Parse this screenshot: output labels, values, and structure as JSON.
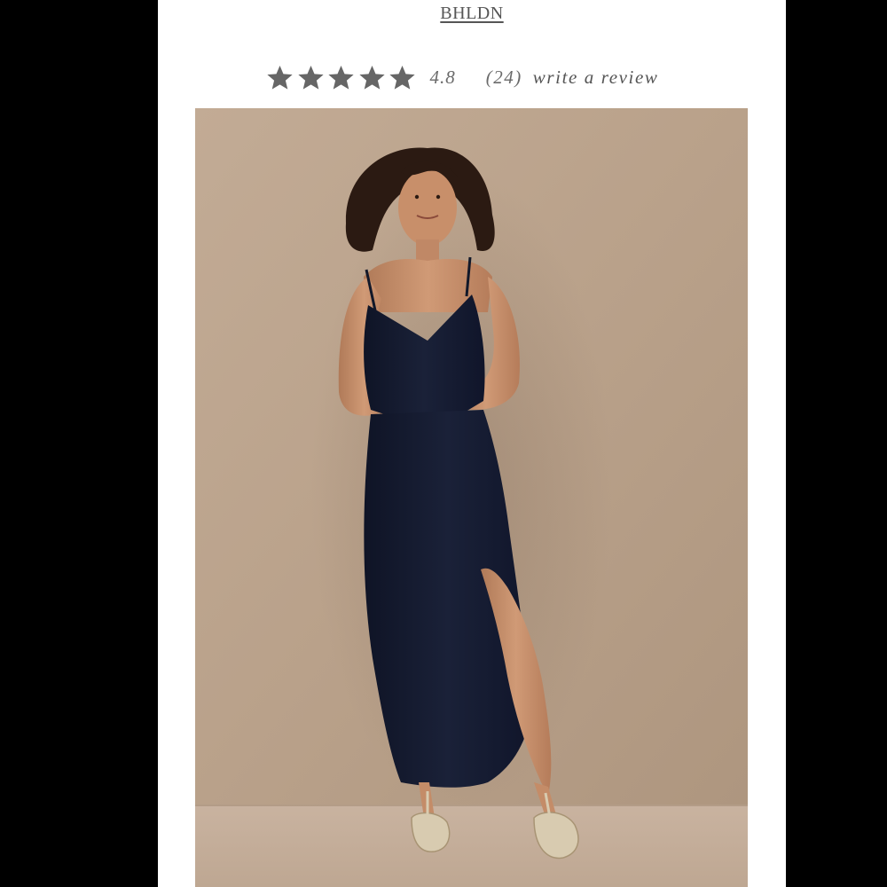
{
  "header": {
    "brand": "BHLDN"
  },
  "rating": {
    "stars_filled": 5,
    "stars_total": 5,
    "value": "4.8",
    "count": "(24)",
    "write_review": "write a review",
    "star_color": "#666666"
  },
  "product_image": {
    "alt": "Model wearing navy slip dress with gold strappy sandals",
    "background_color": "#bba38c",
    "dress_color": "#141a2e"
  }
}
